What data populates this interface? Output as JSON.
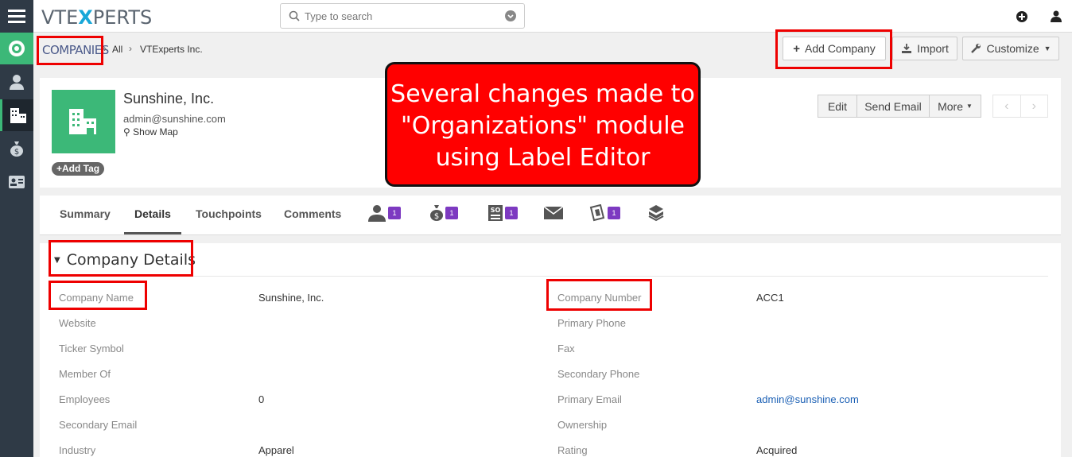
{
  "topbar": {
    "logo_main": "VTE",
    "logo_x": "X",
    "logo_rest": "PERTS",
    "search_placeholder": "Type to search"
  },
  "breadcrumb": {
    "module": "COMPANIES",
    "filter": "All",
    "current": "VTExperts Inc."
  },
  "actions": {
    "add": "Add Company",
    "import": "Import",
    "customize": "Customize"
  },
  "record": {
    "name": "Sunshine, Inc.",
    "email": "admin@sunshine.com",
    "show_map": "Show Map",
    "add_tag": "Add Tag",
    "edit": "Edit",
    "send_email": "Send Email",
    "more": "More"
  },
  "tabs": {
    "summary": "Summary",
    "details": "Details",
    "touchpoints": "Touchpoints",
    "comments": "Comments",
    "badge": "1"
  },
  "section": {
    "title": "Company Details"
  },
  "fields": {
    "left": [
      {
        "label": "Company Name",
        "value": "Sunshine, Inc."
      },
      {
        "label": "Website",
        "value": ""
      },
      {
        "label": "Ticker Symbol",
        "value": ""
      },
      {
        "label": "Member Of",
        "value": ""
      },
      {
        "label": "Employees",
        "value": "0"
      },
      {
        "label": "Secondary Email",
        "value": ""
      },
      {
        "label": "Industry",
        "value": "Apparel"
      }
    ],
    "right": [
      {
        "label": "Company Number",
        "value": "ACC1"
      },
      {
        "label": "Primary Phone",
        "value": ""
      },
      {
        "label": "Fax",
        "value": ""
      },
      {
        "label": "Secondary Phone",
        "value": ""
      },
      {
        "label": "Primary Email",
        "value": "admin@sunshine.com"
      },
      {
        "label": "Ownership",
        "value": ""
      },
      {
        "label": "Rating",
        "value": "Acquired"
      }
    ]
  },
  "callout": {
    "line1": "Several changes made to",
    "line2": "\"Organizations\" module",
    "line3": "using Label Editor"
  },
  "colors": {
    "sidebar": "#2f3a46",
    "accent_green": "#3cb878",
    "highlight_red": "#ee0000",
    "badge_purple": "#7d3ac1",
    "link_blue": "#1a5fb4"
  }
}
